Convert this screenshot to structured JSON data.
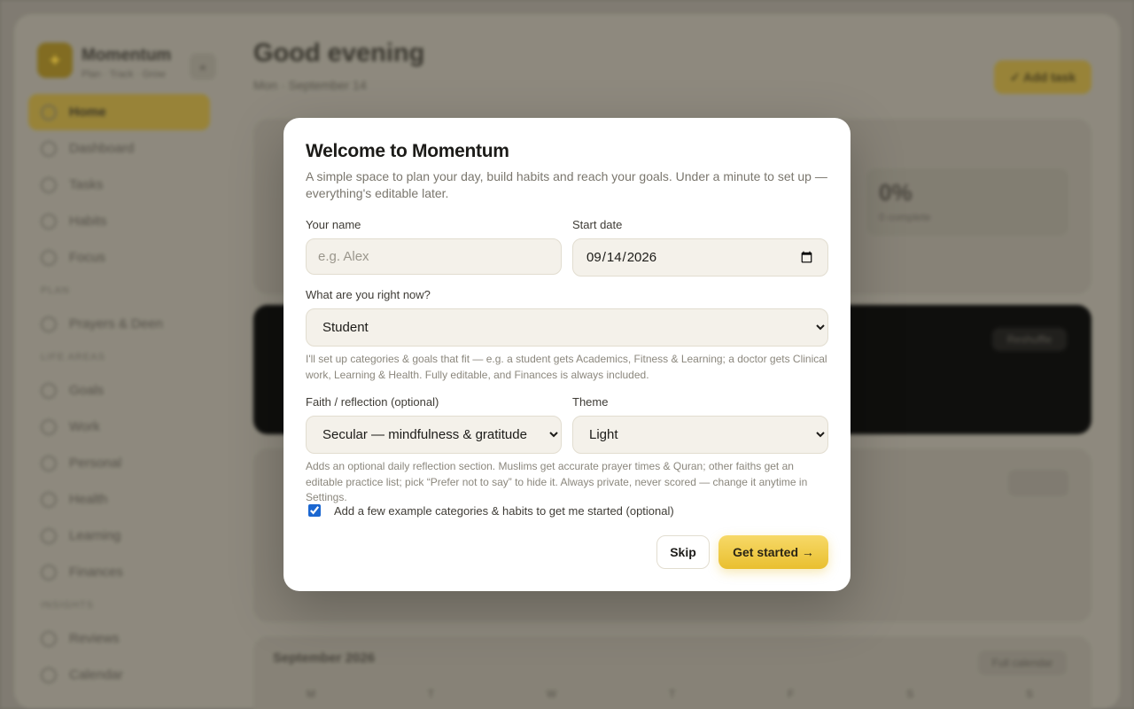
{
  "background": {
    "brand_name": "Momentum",
    "brand_sub": "Plan · Track · Grow",
    "nav": [
      {
        "label": "Home",
        "active": true
      },
      {
        "label": "Dashboard"
      },
      {
        "label": "Tasks"
      },
      {
        "label": "Habits"
      },
      {
        "label": "Focus"
      }
    ],
    "group_plan": "PLAN",
    "nav_plan": [
      {
        "label": "Prayers & Deen"
      }
    ],
    "group_life": "LIFE AREAS",
    "nav_life": [
      {
        "label": "Goals"
      },
      {
        "label": "Work"
      },
      {
        "label": "Personal"
      },
      {
        "label": "Health"
      },
      {
        "label": "Learning"
      },
      {
        "label": "Finances"
      }
    ],
    "group_review": "INSIGHTS",
    "nav_review": [
      {
        "label": "Reviews"
      },
      {
        "label": "Calendar"
      }
    ],
    "greeting": "Good evening",
    "greeting_sub": "Mon · September 14",
    "top_button": "✓ Add task",
    "stat_value": "0%",
    "stat_label": "0 complete",
    "dark_button": "Reshuffle",
    "card2_button": "Add",
    "calendar_title": "September 2026",
    "calendar_button": "Full calendar",
    "calendar_days": [
      "M",
      "T",
      "W",
      "T",
      "F",
      "S",
      "S"
    ]
  },
  "modal": {
    "title": "Welcome to Momentum",
    "intro": "A simple space to plan your day, build habits and reach your goals. Under a minute to set up — everything's editable later.",
    "name_label": "Your name",
    "name_placeholder": "e.g. Alex",
    "start_label": "Start date",
    "start_value": "2026-09-14",
    "role_label": "What are you right now?",
    "role_value": "Student",
    "role_hint": "I'll set up categories & goals that fit — e.g. a student gets Academics, Fitness & Learning; a doctor gets Clinical work, Learning & Health. Fully editable, and Finances is always included.",
    "faith_label": "Faith / reflection (optional)",
    "faith_value": "Secular — mindfulness & gratitude",
    "theme_label": "Theme",
    "theme_value": "Light",
    "faith_hint": "Adds an optional daily reflection section. Muslims get accurate prayer times & Quran; other faiths get an editable practice list; pick “Prefer not to say” to hide it. Always private, never scored — change it anytime in Settings.",
    "examples_label": "Add a few example categories & habits to get me started (optional)",
    "examples_checked": true,
    "skip_label": "Skip",
    "start_button": "Get started →"
  }
}
